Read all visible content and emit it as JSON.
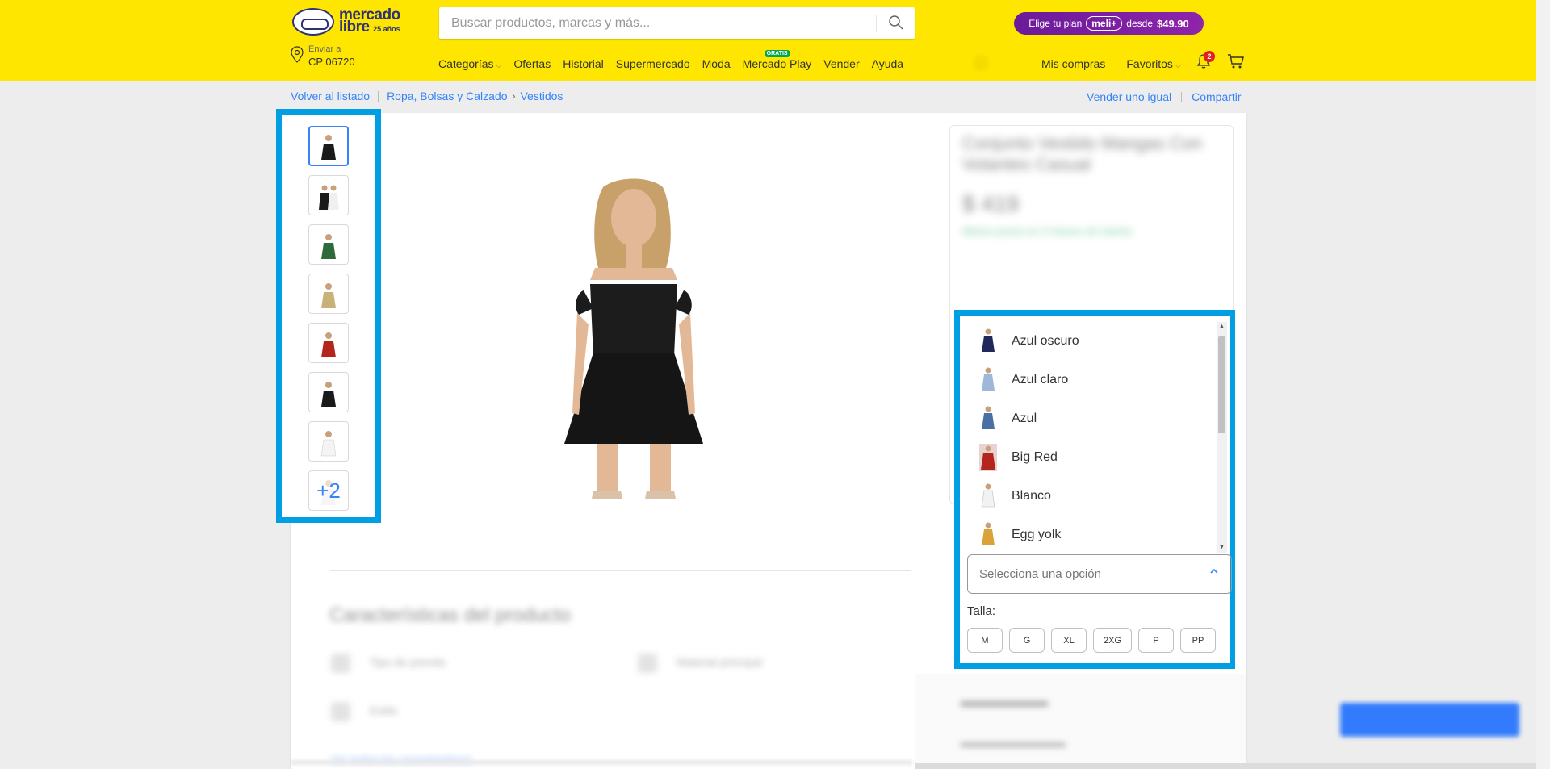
{
  "header": {
    "logo": {
      "line1": "mercado",
      "line2": "libre",
      "badge": "25 años"
    },
    "search_placeholder": "Buscar productos, marcas y más...",
    "plan": {
      "prefix": "Elige tu plan",
      "brand": "meli+",
      "middle": "desde",
      "price": "$49.90"
    },
    "ship": {
      "label": "Enviar a",
      "value": "CP 06720"
    },
    "nav": [
      "Categorías",
      "Ofertas",
      "Historial",
      "Supermercado",
      "Moda",
      "Mercado Play",
      "Vender",
      "Ayuda"
    ],
    "gratis_tag": "GRATIS",
    "right_nav": {
      "purchases": "Mis compras",
      "favorites": "Favoritos"
    },
    "notifications_count": "2"
  },
  "breadcrumb": {
    "back": "Volver al listado",
    "path": [
      "Ropa, Bolsas y Calzado",
      "Vestidos"
    ],
    "sell_similar": "Vender uno igual",
    "share": "Compartir"
  },
  "gallery": {
    "more_count": "+2",
    "thumb_colors": [
      "#1a1a1a",
      "#1a1a1a",
      "#2f6b3a",
      "#c9b27a",
      "#b3261e",
      "#1a1a1a",
      "#f0f0f0",
      "#e8e8e8"
    ]
  },
  "product": {
    "title_blurred": "Conjunto Vestido Mangas Con Volantes Casual",
    "price_blurred": "$ 419",
    "promo_blurred": "Mismo precio en 3 meses sin interés"
  },
  "features_blurred": {
    "title": "Características del producto",
    "row1": "Tipo de prenda",
    "row2": "Material principal",
    "row3": "Estilo",
    "link": "Ver todas las características"
  },
  "variant_dropdown": {
    "options": [
      {
        "label": "Azul oscuro",
        "color": "#1f2a5a"
      },
      {
        "label": "Azul claro",
        "color": "#9fb7d9"
      },
      {
        "label": "Azul",
        "color": "#4a6fa5"
      },
      {
        "label": "Big Red",
        "color": "#b3261e"
      },
      {
        "label": "Blanco",
        "color": "#f2f2f2"
      },
      {
        "label": "Egg yolk",
        "color": "#d9a33a"
      }
    ],
    "placeholder": "Selecciona una opción",
    "size_label": "Talla:",
    "sizes": [
      "M",
      "G",
      "XL",
      "2XG",
      "P",
      "PP"
    ]
  },
  "colors": {
    "brand_yellow": "#ffe600",
    "accent_blue": "#3483fa",
    "highlight_frame": "#009ee3"
  }
}
